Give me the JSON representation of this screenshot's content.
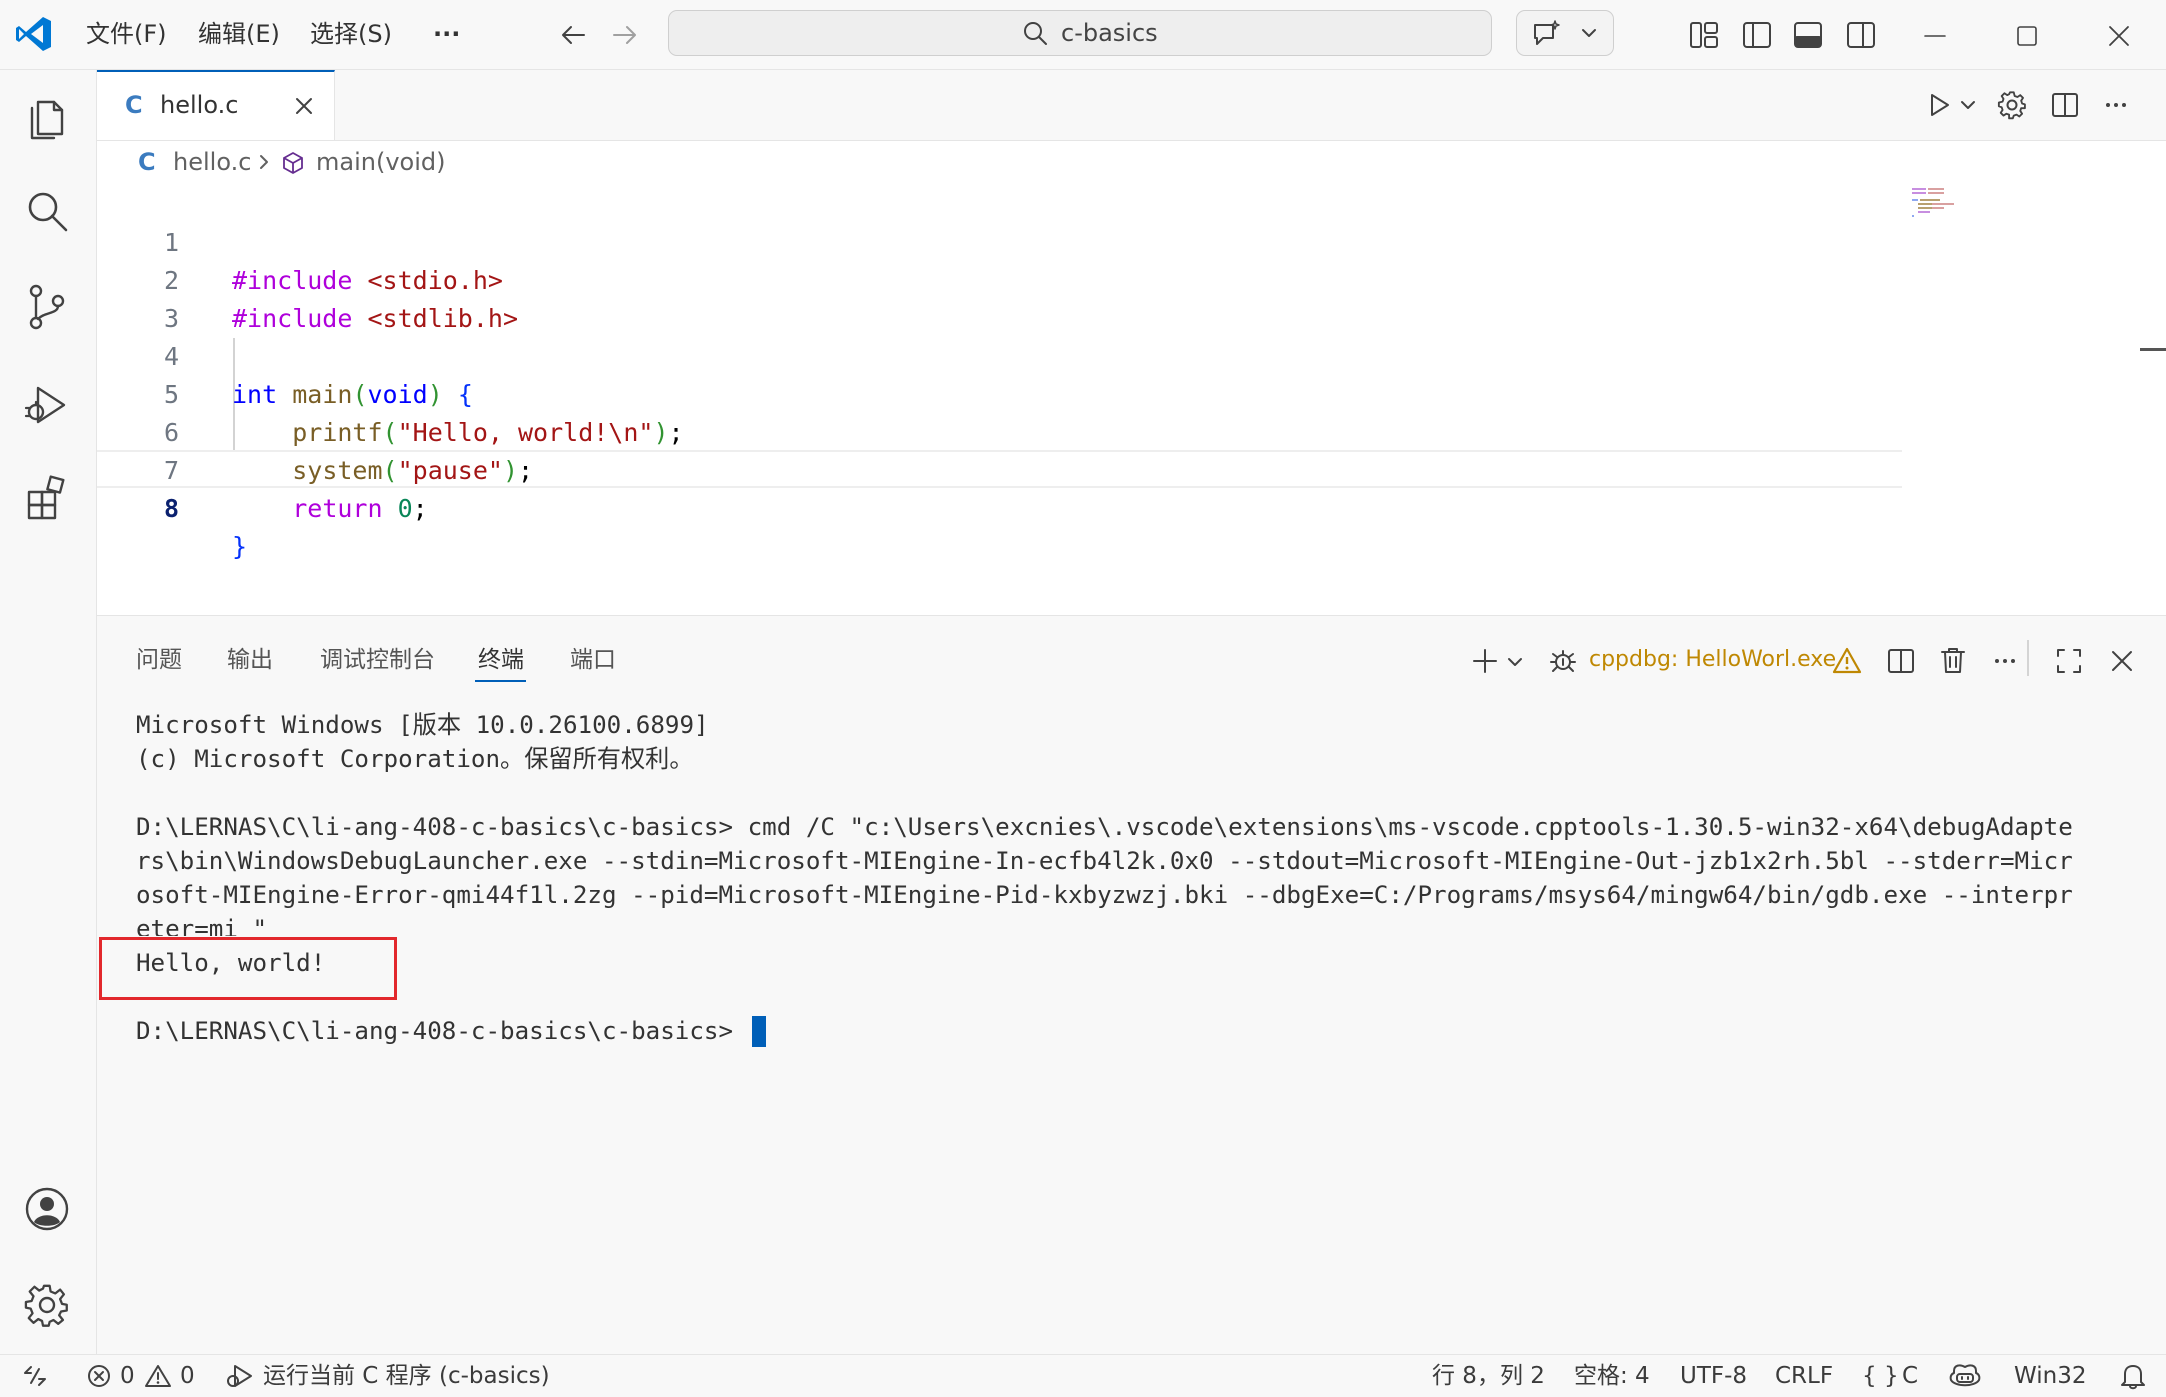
{
  "menu": {
    "file": "文件(F)",
    "edit": "编辑(E)",
    "selection": "选择(S)",
    "more": "···"
  },
  "search": {
    "label": "c-basics"
  },
  "editor": {
    "tab": {
      "label": "hello.c",
      "icon_letter": "C"
    },
    "breadcrumb": {
      "file": "hello.c",
      "symbol": "main(void)"
    },
    "lines": [
      {
        "num": "1"
      },
      {
        "num": "2"
      },
      {
        "num": "3"
      },
      {
        "num": "4"
      },
      {
        "num": "5"
      },
      {
        "num": "6"
      },
      {
        "num": "7"
      },
      {
        "num": "8"
      }
    ],
    "code": {
      "include_kw": "#include",
      "stdio": "<stdio.h>",
      "stdlib": "<stdlib.h>",
      "int_kw": "int",
      "main_fn": "main",
      "void_kw": "void",
      "printf_fn": "printf",
      "hello_str": "\"Hello, world!\\n\"",
      "system_fn": "system",
      "pause_str": "\"pause\"",
      "return_kw": "return",
      "zero": "0"
    }
  },
  "panel": {
    "tabs": {
      "problems": "问题",
      "output": "输出",
      "debug_console": "调试控制台",
      "terminal": "终端",
      "ports": "端口"
    },
    "session_label": "cppdbg: HelloWorl.exe",
    "terminal_lines": [
      "Microsoft Windows [版本 10.0.26100.6899]",
      "(c) Microsoft Corporation。保留所有权利。",
      "",
      "D:\\LERNAS\\C\\li-ang-408-c-basics\\c-basics> cmd /C \"c:\\Users\\excnies\\.vscode\\extensions\\ms-vscode.cpptools-1.30.5-win32-x64\\debugAdapte",
      "rs\\bin\\WindowsDebugLauncher.exe --stdin=Microsoft-MIEngine-In-ecfb4l2k.0x0 --stdout=Microsoft-MIEngine-Out-jzb1x2rh.5bl --stderr=Micr",
      "osoft-MIEngine-Error-qmi44f1l.2zg --pid=Microsoft-MIEngine-Pid-kxbyzwzj.bki --dbgExe=C:/Programs/msys64/mingw64/bin/gdb.exe --interpr",
      "eter=mi \"",
      "Hello, world!",
      "",
      "D:\\LERNAS\\C\\li-ang-408-c-basics\\c-basics>"
    ]
  },
  "status": {
    "errors": "0",
    "warnings": "0",
    "run_label": "运行当前 C 程序 (c-basics)",
    "position": "行 8，列 2",
    "spaces": "空格: 4",
    "encoding": "UTF-8",
    "eol": "CRLF",
    "lang_braces": "{ }",
    "language": "C",
    "platform": "Win32"
  },
  "colors": {
    "accent": "#005fb8",
    "vscode_logo": "#0078d4",
    "highlight_box": "#e2282c",
    "warning": "#bf8803"
  }
}
